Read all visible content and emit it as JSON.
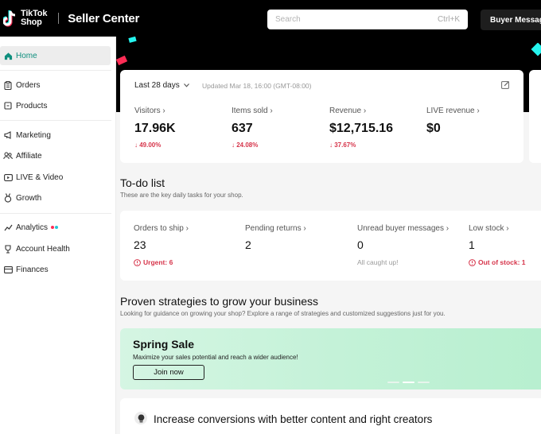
{
  "header": {
    "logo_line1": "TikTok",
    "logo_line2": "Shop",
    "title": "Seller Center",
    "search_placeholder": "Search",
    "search_shortcut": "Ctrl+K",
    "buyer_messages_label": "Buyer Messages"
  },
  "sidebar": {
    "items": [
      {
        "label": "Home",
        "icon": "home-icon"
      },
      {
        "label": "Orders",
        "icon": "clipboard-icon"
      },
      {
        "label": "Products",
        "icon": "box-icon"
      },
      {
        "label": "Marketing",
        "icon": "megaphone-icon"
      },
      {
        "label": "Affiliate",
        "icon": "users-icon"
      },
      {
        "label": "LIVE & Video",
        "icon": "video-icon"
      },
      {
        "label": "Growth",
        "icon": "medal-icon"
      },
      {
        "label": "Analytics",
        "icon": "chart-icon"
      },
      {
        "label": "Account Health",
        "icon": "trophy-icon"
      },
      {
        "label": "Finances",
        "icon": "card-icon"
      }
    ]
  },
  "stats": {
    "range": "Last 28 days",
    "updated": "Updated Mar 18, 16:00 (GMT-08:00)",
    "items": [
      {
        "label": "Visitors",
        "value": "17.96K",
        "delta": "49.00%"
      },
      {
        "label": "Items sold",
        "value": "637",
        "delta": "24.08%"
      },
      {
        "label": "Revenue",
        "value": "$12,715.16",
        "delta": "37.67%"
      },
      {
        "label": "LIVE revenue",
        "value": "$0",
        "delta": ""
      }
    ]
  },
  "todo": {
    "title": "To-do list",
    "subtitle": "These are the key daily tasks for your shop.",
    "items": [
      {
        "label": "Orders to ship",
        "value": "23",
        "note": "Urgent: 6",
        "note_type": "warn"
      },
      {
        "label": "Pending returns",
        "value": "2",
        "note": "",
        "note_type": "none"
      },
      {
        "label": "Unread buyer messages",
        "value": "0",
        "note": "All caught up!",
        "note_type": "ok"
      },
      {
        "label": "Low stock",
        "value": "1",
        "note": "Out of stock: 1",
        "note_type": "warn"
      }
    ]
  },
  "strategies": {
    "title": "Proven strategies to grow your business",
    "subtitle": "Looking for guidance on growing your shop? Explore a range of strategies and customized suggestions just for you."
  },
  "promo": {
    "title": "Spring Sale",
    "description": "Maximize your sales potential and reach a wider audience!",
    "button": "Join now"
  },
  "tip": {
    "text": "Increase conversions with better content and right creators"
  },
  "colors": {
    "accent": "#0f8f7e",
    "negative": "#d6344a",
    "tiktok_cyan": "#25f4ee",
    "tiktok_pink": "#fe2c55"
  }
}
